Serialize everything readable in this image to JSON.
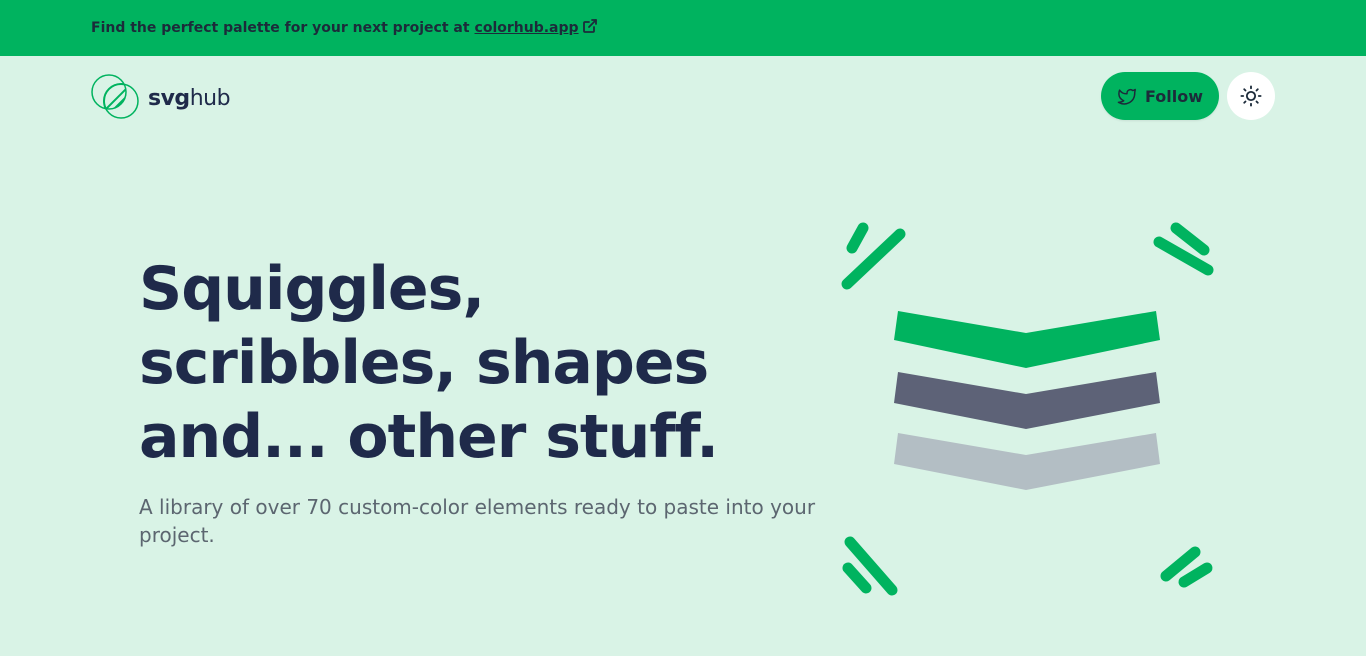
{
  "banner": {
    "text": "Find the perfect palette for your next project at",
    "link_label": "colorhub.app",
    "icon": "external-link-icon"
  },
  "header": {
    "logo": {
      "text_bold": "svg",
      "text_regular": "hub",
      "icon": "svghub-logo-icon"
    },
    "follow_button": {
      "label": "Follow",
      "icon": "twitter-bird-icon"
    },
    "theme_toggle": {
      "icon": "sun-icon"
    }
  },
  "hero": {
    "title": "Squiggles, scribbles, shapes and... other stuff.",
    "subtitle": "A library of over 70 custom-color elements ready to paste into your project."
  },
  "colors": {
    "banner_bg": "#00b35f",
    "page_bg": "#d9f3e6",
    "accent_green": "#00b35f",
    "heading_navy": "#1f2a4a",
    "subtext_gray": "#5c6670",
    "chevron_dark": "#5d6277",
    "chevron_light": "#b3bec4"
  },
  "illustration": {
    "icon": "stacked-chevrons-illustration"
  }
}
